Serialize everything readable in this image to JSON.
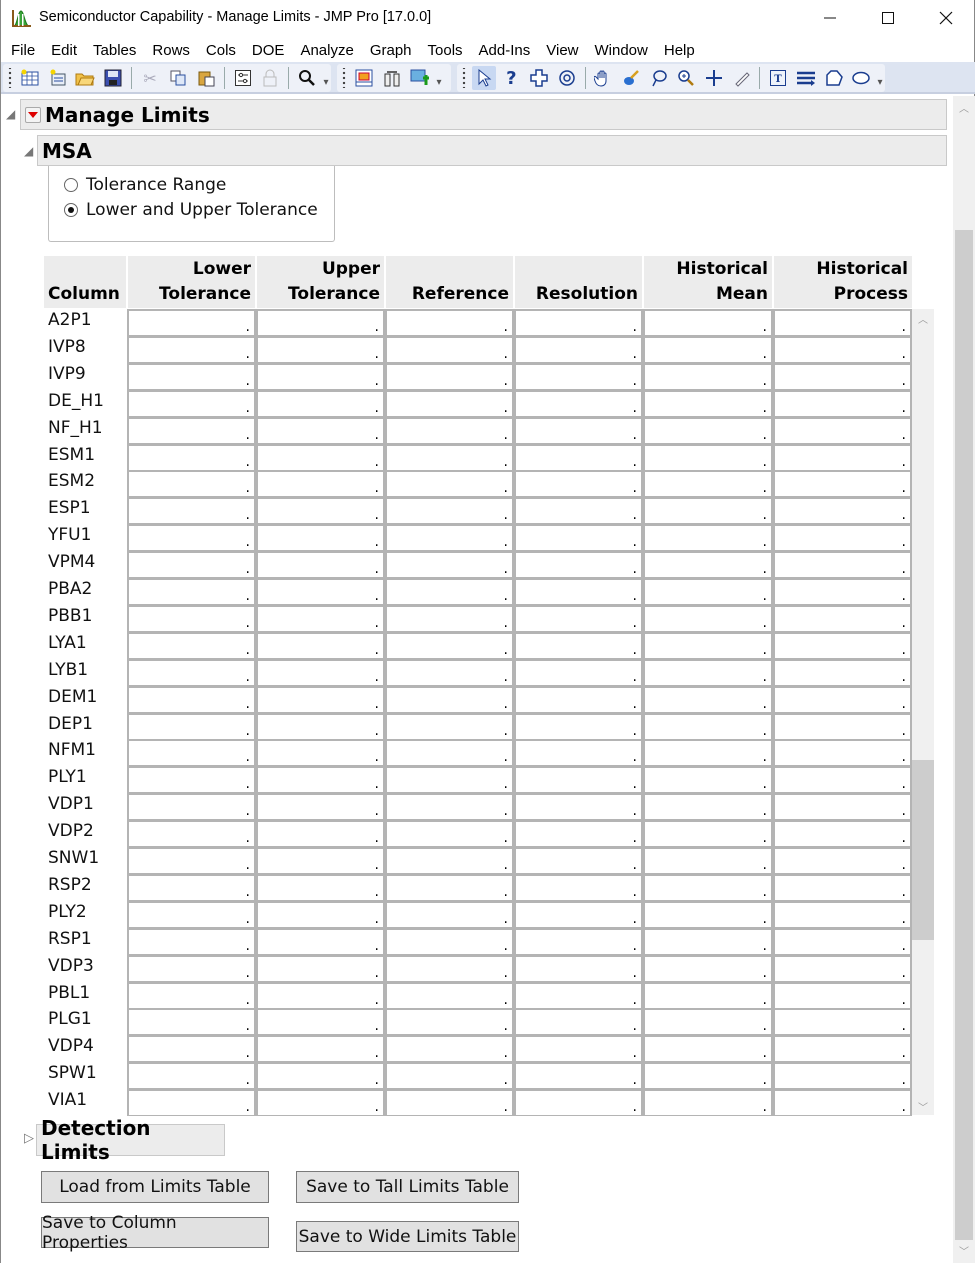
{
  "window": {
    "title": "Semiconductor Capability - Manage Limits - JMP Pro [17.0.0]",
    "controls": {
      "minimize": "—",
      "maximize": "☐",
      "close": "✕"
    }
  },
  "menu": [
    "File",
    "Edit",
    "Tables",
    "Rows",
    "Cols",
    "DOE",
    "Analyze",
    "Graph",
    "Tools",
    "Add-Ins",
    "View",
    "Window",
    "Help"
  ],
  "toolbar": {
    "group1": [
      "new-data-table-icon",
      "new-script-icon",
      "open-icon",
      "save-icon",
      "cut-icon",
      "copy-icon",
      "paste-icon",
      "preferences-icon",
      "lock-icon",
      "search-icon"
    ],
    "group2": [
      "data-view-icon",
      "columns-icon",
      "add-graph-icon"
    ],
    "group3": [
      "arrow-tool-icon",
      "help-tool-icon",
      "crosshair-tool-icon",
      "selection-tool-icon",
      "hand-tool-icon",
      "brush-tool-icon",
      "lasso-tool-icon",
      "magnifier-tool-icon",
      "plus-tool-icon",
      "line-tool-icon",
      "annotate-tool-icon",
      "simple-shape-icon",
      "polygon-tool-icon",
      "ellipse-tool-icon"
    ]
  },
  "report": {
    "title": "Manage Limits",
    "msa": {
      "title": "MSA",
      "options": [
        {
          "label": "Tolerance Range",
          "checked": false
        },
        {
          "label": "Lower and Upper Tolerance",
          "checked": true
        }
      ]
    },
    "table": {
      "headers": [
        "Column",
        "Lower\nTolerance",
        "Upper\nTolerance",
        "Reference",
        "Resolution",
        "Historical\nMean",
        "Historical\nProcess Sigma"
      ],
      "missing_value": ".",
      "rows": [
        "A2P1",
        "IVP8",
        "IVP9",
        "DE_H1",
        "NF_H1",
        "ESM1",
        "ESM2",
        "ESP1",
        "YFU1",
        "VPM4",
        "PBA2",
        "PBB1",
        "LYA1",
        "LYB1",
        "DEM1",
        "DEP1",
        "NFM1",
        "PLY1",
        "VDP1",
        "VDP2",
        "SNW1",
        "RSP2",
        "PLY2",
        "RSP1",
        "VDP3",
        "PBL1",
        "PLG1",
        "VDP4",
        "SPW1",
        "VIA1"
      ]
    },
    "detection_limits": {
      "title": "Detection Limits",
      "expanded": false
    },
    "buttons": {
      "load_from_limits_table": "Load from Limits Table",
      "save_to_tall_limits_table": "Save to Tall Limits Table",
      "save_to_column_properties": "Save to Column Properties",
      "save_to_wide_limits_table": "Save to Wide Limits Table"
    }
  }
}
